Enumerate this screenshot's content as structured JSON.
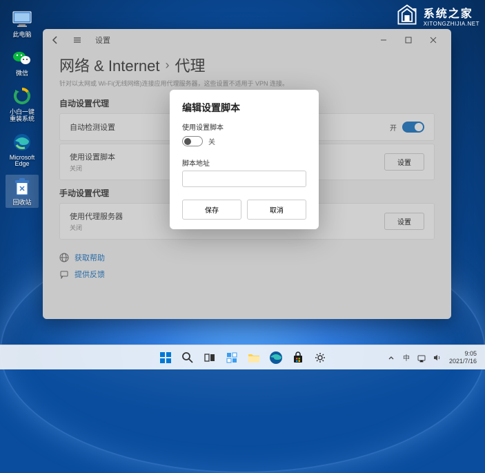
{
  "watermark": {
    "cn": "系统之家",
    "en": "XITONGZHIJIA.NET"
  },
  "desktop": {
    "icons": [
      {
        "name": "this-pc",
        "label": "此电脑"
      },
      {
        "name": "wechat",
        "label": "微信"
      },
      {
        "name": "xiaobaireinstall",
        "label": "小白一键重装系统"
      },
      {
        "name": "edge",
        "label": "Microsoft Edge"
      },
      {
        "name": "recycle-bin",
        "label": "回收站"
      }
    ]
  },
  "settings": {
    "app_title": "设置",
    "breadcrumb": {
      "parent": "网络 & Internet",
      "current": "代理"
    },
    "description": "针对以太网或 Wi-Fi(无线网络)连接应用代理服务器，这些设置不适用于 VPN 连接。",
    "auto_section": "自动设置代理",
    "auto_detect": {
      "label": "自动检测设置",
      "toggle_label": "开"
    },
    "use_script": {
      "label": "使用设置脚本",
      "sub": "关闭",
      "button": "设置"
    },
    "manual_section": "手动设置代理",
    "use_proxy": {
      "label": "使用代理服务器",
      "sub": "关闭",
      "button": "设置"
    },
    "help": {
      "get_help": "获取帮助",
      "feedback": "提供反馈"
    }
  },
  "dialog": {
    "title": "编辑设置脚本",
    "use_script_label": "使用设置脚本",
    "toggle_state": "关",
    "address_label": "脚本地址",
    "address_value": "",
    "save": "保存",
    "cancel": "取消"
  },
  "taskbar": {
    "time": "9:05",
    "date": "2021/7/16"
  }
}
